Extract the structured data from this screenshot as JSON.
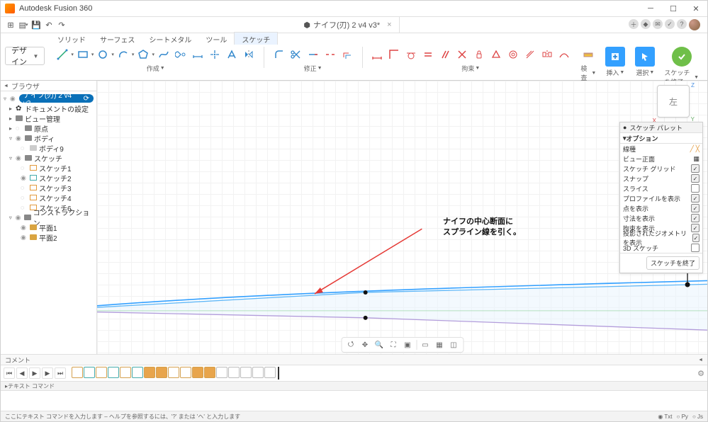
{
  "app": {
    "title": "Autodesk Fusion 360"
  },
  "doc": {
    "tab_title": "ナイフ(刃) 2 v4 v3*",
    "close_glyph": "×"
  },
  "qat": {
    "grid": "⊞",
    "save": "▾",
    "undo": "↶",
    "redo": "↷"
  },
  "design_tabs": {
    "items": [
      "ソリッド",
      "サーフェス",
      "シートメタル",
      "ツール",
      "スケッチ"
    ],
    "active": 4
  },
  "ribbon": {
    "design_label": "デザイン",
    "groups": {
      "create": {
        "label": "作成"
      },
      "modify": {
        "label": "修正"
      },
      "constr": {
        "label": "拘束"
      },
      "inspect": {
        "label": "検査"
      },
      "insert": {
        "label": "挿入"
      },
      "select": {
        "label": "選択"
      },
      "finish": {
        "label": "スケッチを終了"
      }
    }
  },
  "browser": {
    "title": "ブラウザ",
    "root": "ナイフ(刃) 2 v4 v3",
    "doc_settings": "ドキュメントの設定",
    "views": "ビュー管理",
    "origin": "原点",
    "bodies": "ボディ",
    "body": "ボディ9",
    "sketches": "スケッチ",
    "sk": [
      "スケッチ1",
      "スケッチ2",
      "スケッチ3",
      "スケッチ4",
      "スケッチ6"
    ],
    "constr": "コンストラクション",
    "pl": [
      "平面1",
      "平面2"
    ]
  },
  "viewcube": {
    "face": "左"
  },
  "annotation": {
    "line1": "ナイフの中心断面に",
    "line2": "スプライン線を引く。"
  },
  "palette": {
    "title": "スケッチ パレット",
    "options": "オプション",
    "rows": [
      {
        "label": "線種",
        "ctrl": "linetype"
      },
      {
        "label": "ビュー正面",
        "ctrl": "lookat"
      },
      {
        "label": "スケッチ グリッド",
        "checked": true
      },
      {
        "label": "スナップ",
        "checked": true
      },
      {
        "label": "スライス",
        "checked": false
      },
      {
        "label": "プロファイルを表示",
        "checked": true
      },
      {
        "label": "点を表示",
        "checked": true
      },
      {
        "label": "寸法を表示",
        "checked": true
      },
      {
        "label": "拘束を表示",
        "checked": true
      },
      {
        "label": "投影されたジオメトリを表示",
        "checked": true
      },
      {
        "label": "3D スケッチ",
        "checked": false
      }
    ],
    "finish": "スケッチを終了"
  },
  "comment": {
    "label": "コメント"
  },
  "textcmd": {
    "label": "テキスト コマンド"
  },
  "status": {
    "hint": "ここにテキスト コマンドを入力します – ヘルプを参照するには、'?' または 'ヘ' と入力します",
    "txt": "Txt",
    "py": "Py",
    "js": "Js"
  }
}
